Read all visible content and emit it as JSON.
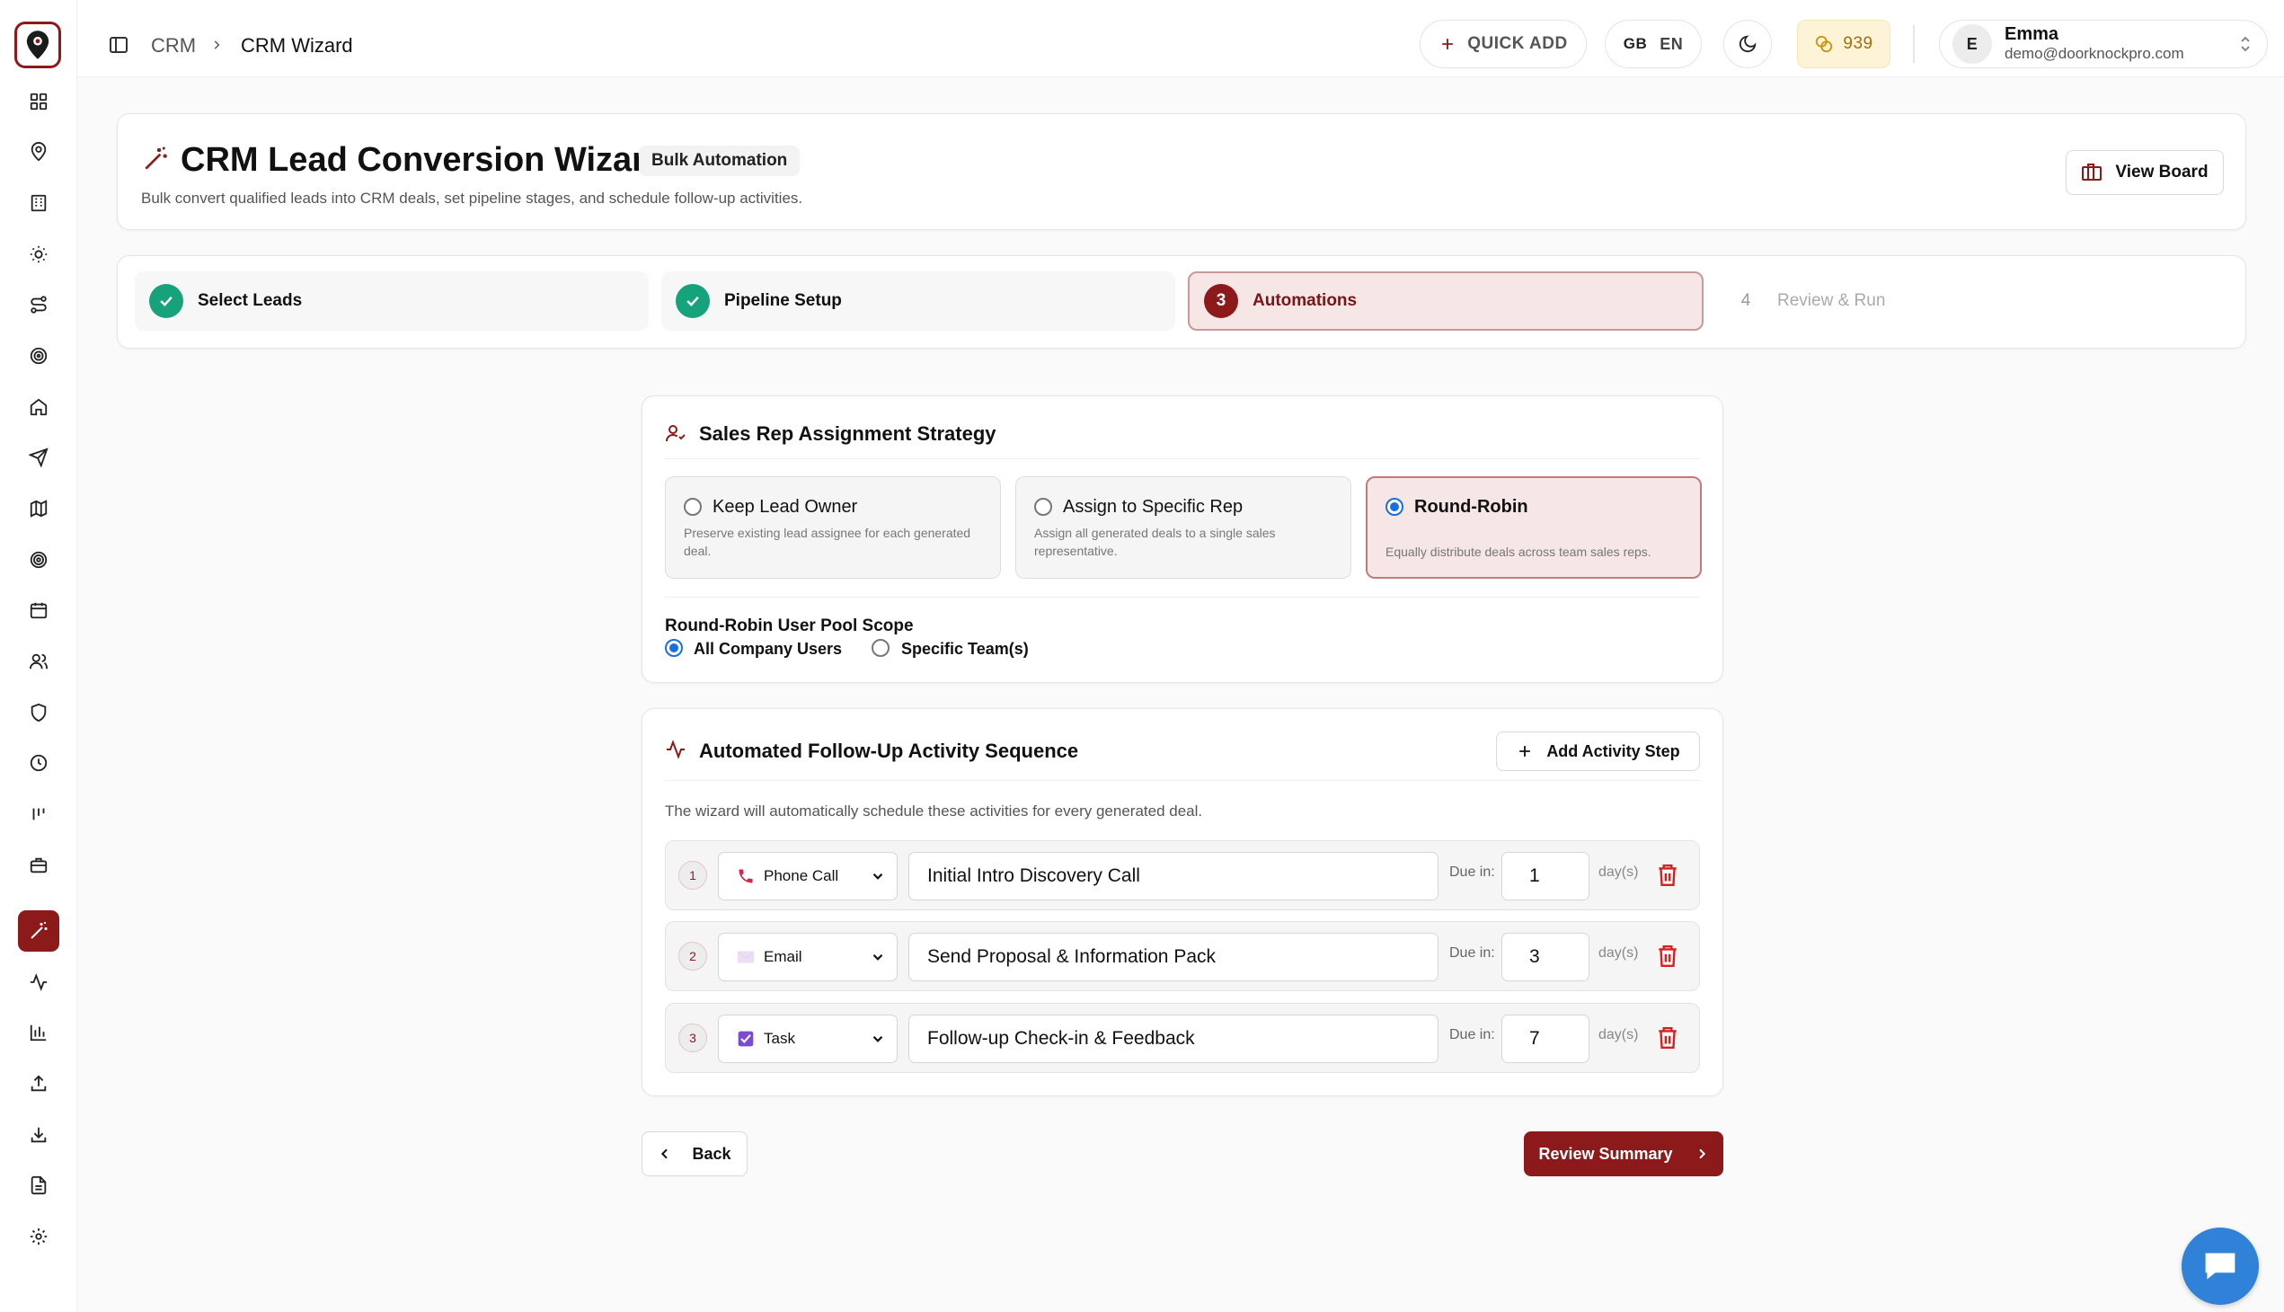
{
  "header": {
    "breadcrumb": [
      "CRM",
      "CRM Wizard"
    ],
    "quick_add": "QUICK ADD",
    "lang_flag": "GB",
    "lang_code": "EN",
    "credits": "939",
    "user": {
      "initial": "E",
      "name": "Emma",
      "email": "demo@doorknockpro.com"
    }
  },
  "sidebar": {
    "icons": [
      "grid-icon",
      "map-pin-icon",
      "building-icon",
      "sun-icon",
      "route-icon",
      "target-icon",
      "home-icon",
      "send-icon",
      "map-icon",
      "radar-icon",
      "calendar-icon",
      "users-icon",
      "shield-icon",
      "clock-icon",
      "kanban-icon",
      "briefcase-icon",
      "wand-icon",
      "activity-icon",
      "bar-chart-icon",
      "upload-icon",
      "download-icon",
      "file-text-icon",
      "settings-icon"
    ],
    "active_index": 16
  },
  "page": {
    "title": "CRM Lead Conversion Wizard",
    "badge": "Bulk Automation",
    "subtitle": "Bulk convert qualified leads into CRM deals, set pipeline stages, and schedule follow-up activities.",
    "view_board": "View Board"
  },
  "steps": [
    {
      "label": "Select Leads",
      "state": "done"
    },
    {
      "label": "Pipeline Setup",
      "state": "done"
    },
    {
      "number": "3",
      "label": "Automations",
      "state": "active"
    },
    {
      "number": "4",
      "label": "Review & Run",
      "state": "todo"
    }
  ],
  "assignment": {
    "title": "Sales Rep Assignment Strategy",
    "options": [
      {
        "label": "Keep Lead Owner",
        "desc": "Preserve existing lead assignee for each generated deal.",
        "selected": false
      },
      {
        "label": "Assign to Specific Rep",
        "desc": "Assign all generated deals to a single sales representative.",
        "selected": false
      },
      {
        "label": "Round-Robin",
        "desc": "Equally distribute deals across team sales reps.",
        "selected": true
      }
    ],
    "pool_title": "Round-Robin User Pool Scope",
    "pool_options": [
      {
        "label": "All Company Users",
        "selected": true
      },
      {
        "label": "Specific Team(s)",
        "selected": false
      }
    ]
  },
  "followup": {
    "title": "Automated Follow-Up Activity Sequence",
    "add_step": "Add Activity Step",
    "description": "The wizard will automatically schedule these activities for every generated deal.",
    "due_label": "Due in:",
    "unit": "day(s)",
    "rows": [
      {
        "num": "1",
        "type": "Phone Call",
        "icon": "phone-icon",
        "subject": "Initial Intro Discovery Call",
        "due": "1"
      },
      {
        "num": "2",
        "type": "Email",
        "icon": "envelope-icon",
        "subject": "Send Proposal & Information Pack",
        "due": "3"
      },
      {
        "num": "3",
        "type": "Task",
        "icon": "checkbox-icon",
        "subject": "Follow-up Check-in & Feedback",
        "due": "7"
      }
    ]
  },
  "nav": {
    "back": "Back",
    "next": "Review Summary"
  },
  "colors": {
    "brand": "#8c1a1a",
    "success": "#16a37b",
    "radio": "#1a6fe0",
    "credits_bg": "#fdf3d6"
  }
}
